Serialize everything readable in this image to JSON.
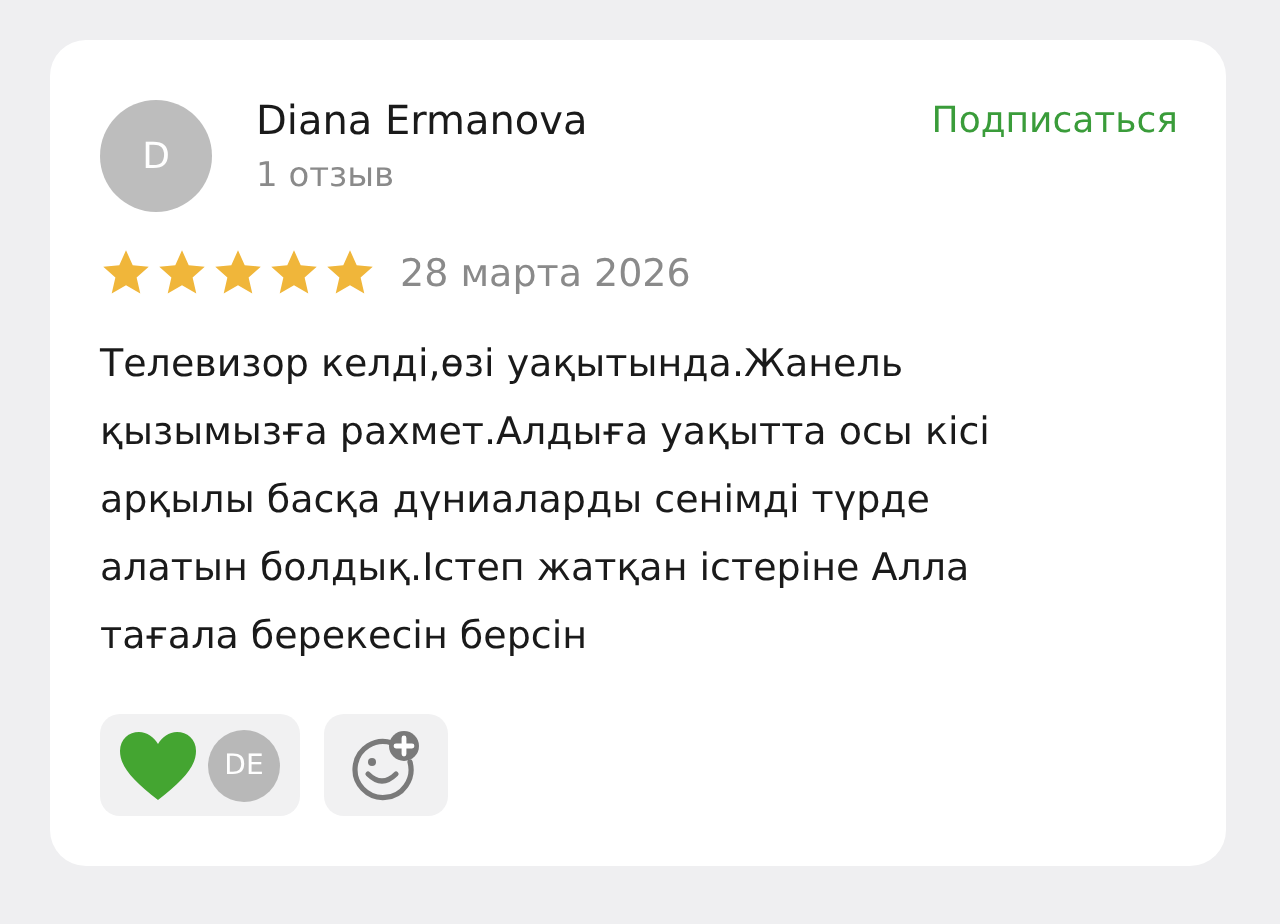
{
  "review": {
    "author": {
      "initial": "D",
      "name": "Diana Ermanova",
      "reviews_count": "1 отзыв"
    },
    "subscribe": "Подписаться",
    "stars": 5,
    "date": "28 марта 2026",
    "text": "Телевизор келді,өзі уақытында.Жанель қызымызға рахмет.Алдыға уақытта осы кісі арқылы басқа дүниаларды сенімді түрде алатын болдық.Істеп жатқан істеріне Алла тағала берекесін берсін",
    "reactions": [
      {
        "reactor_initials": "DE"
      }
    ]
  }
}
